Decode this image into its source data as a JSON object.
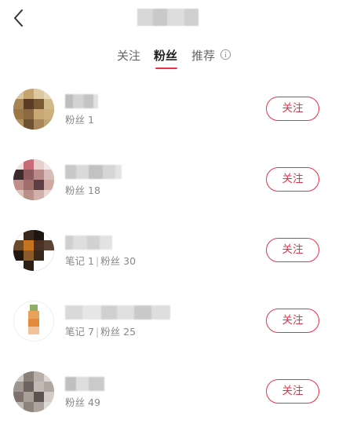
{
  "header": {
    "title_blurred": true
  },
  "tabs": [
    {
      "label": "关注",
      "active": false
    },
    {
      "label": "粉丝",
      "active": true
    },
    {
      "label": "推荐",
      "active": false
    }
  ],
  "accent_color": "#e8324a",
  "users": [
    {
      "fans_label": "粉丝",
      "fans": "1",
      "notes_label": "",
      "notes": "",
      "follow_label": "关注"
    },
    {
      "fans_label": "粉丝",
      "fans": "18",
      "notes_label": "",
      "notes": "",
      "follow_label": "关注"
    },
    {
      "fans_label": "粉丝",
      "fans": "30",
      "notes_label": "笔记",
      "notes": "1",
      "follow_label": "关注"
    },
    {
      "fans_label": "粉丝",
      "fans": "25",
      "notes_label": "笔记",
      "notes": "7",
      "follow_label": "关注"
    },
    {
      "fans_label": "粉丝",
      "fans": "49",
      "notes_label": "",
      "notes": "",
      "follow_label": "关注"
    }
  ],
  "icons": {
    "back": "chevron-left-icon",
    "info": "info-circle-icon"
  }
}
